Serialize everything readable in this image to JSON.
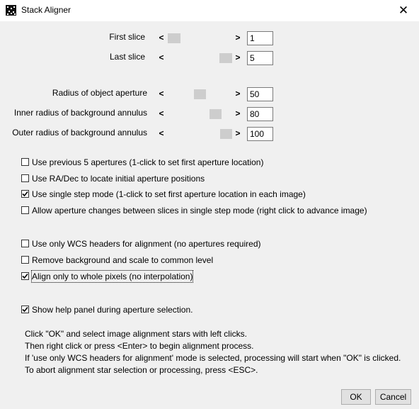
{
  "window": {
    "title": "Stack Aligner",
    "close_glyph": "✕"
  },
  "arrows": {
    "left": "<",
    "right": ">"
  },
  "sliders": [
    {
      "label": "First slice",
      "value": "1"
    },
    {
      "label": "Last slice",
      "value": "5"
    },
    {
      "label": "Radius of object aperture",
      "value": "50"
    },
    {
      "label": "Inner radius of background annulus",
      "value": "80"
    },
    {
      "label": "Outer radius of background annulus",
      "value": "100"
    }
  ],
  "checkboxes": [
    {
      "label": "Use previous 5 apertures (1-click to set first aperture location)",
      "checked": false
    },
    {
      "label": "Use RA/Dec to locate initial aperture positions",
      "checked": false
    },
    {
      "label": "Use single step mode (1-click to set first aperture location in each image)",
      "checked": true
    },
    {
      "label": "Allow aperture changes between slices in single step mode (right click to advance image)",
      "checked": false
    },
    {
      "label": "Use only WCS headers for alignment (no apertures required)",
      "checked": false
    },
    {
      "label": "Remove background and scale to common level",
      "checked": false
    },
    {
      "label": "Align only to whole pixels (no interpolation)",
      "checked": true
    },
    {
      "label": "Show help panel during aperture selection.",
      "checked": true
    }
  ],
  "help_lines": [
    "Click \"OK\" and select image alignment stars with left clicks.",
    "Then right click or press <Enter> to begin alignment process.",
    "If 'use only WCS headers for alignment' mode is selected, processing will start when \"OK\" is clicked.",
    "To abort alignment star selection or processing, press <ESC>."
  ],
  "buttons": {
    "ok": "OK",
    "cancel": "Cancel"
  },
  "icons": {
    "app": "stack-aligner-app-icon",
    "close": "close-icon",
    "check": "checkmark-icon",
    "left": "left-arrow-icon",
    "right": "right-arrow-icon"
  }
}
